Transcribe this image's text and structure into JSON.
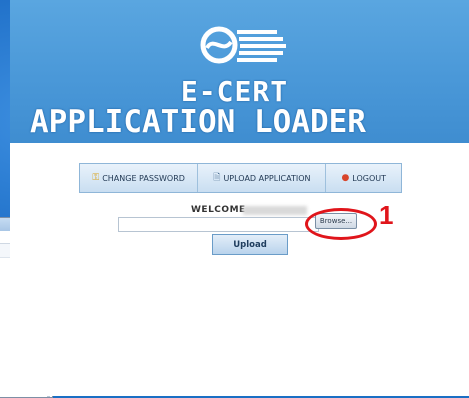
{
  "app": {
    "title_line1": "E-CERT",
    "title_line2": "APPLICATION LOADER"
  },
  "nav": {
    "items": [
      {
        "label": "CHANGE PASSWORD",
        "icon": "key-icon"
      },
      {
        "label": "UPLOAD APPLICATION",
        "icon": "document-icon"
      },
      {
        "label": "LOGOUT",
        "icon": "logout-icon"
      }
    ]
  },
  "welcome": {
    "label": "WELCOME"
  },
  "upload": {
    "file_value": "",
    "browse_label": "Browse...",
    "submit_label": "Upload"
  },
  "annotation": {
    "callout_number": "1",
    "color": "#e0151b"
  },
  "background_window": {
    "close_label": "x"
  },
  "colors": {
    "header_blue": "#4a98d8",
    "desktop_blue": "#1565c0",
    "nav_bg": "#c9def1"
  }
}
